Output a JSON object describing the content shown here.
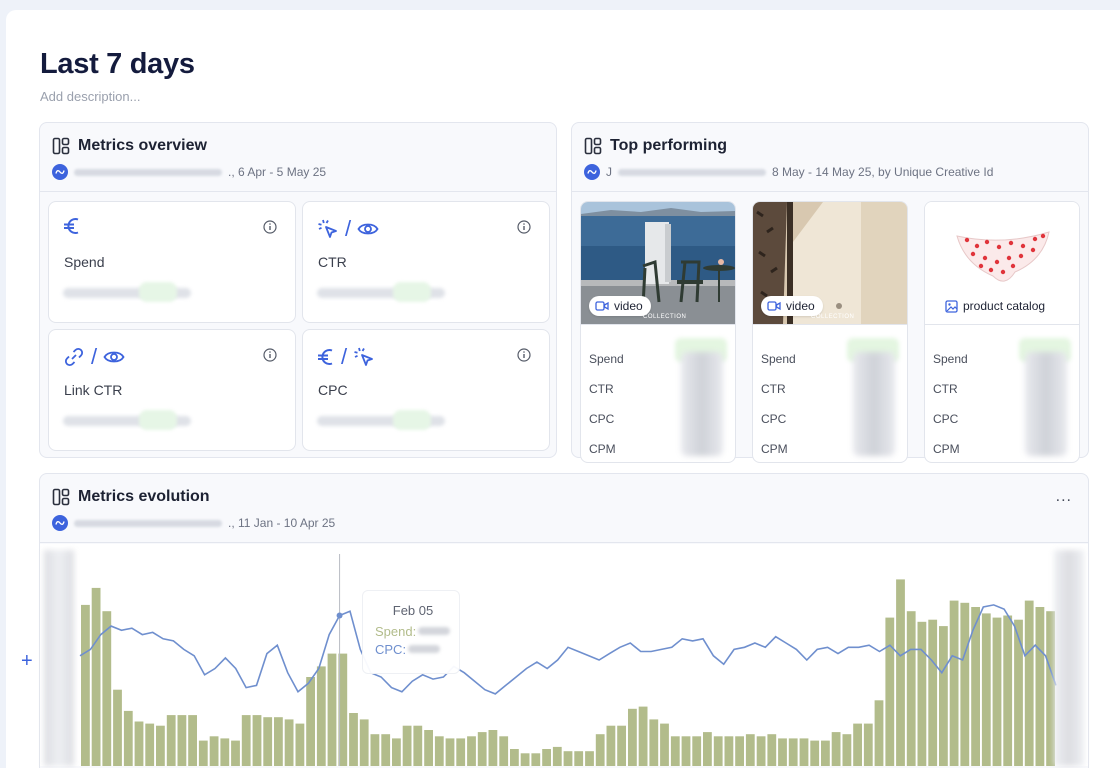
{
  "page": {
    "title": "Last 7 days",
    "description_placeholder": "Add description..."
  },
  "metrics_overview": {
    "title": "Metrics overview",
    "date_range": "., 6 Apr - 5 May 25",
    "cards": [
      {
        "label": "Spend",
        "icons": [
          "euro-icon"
        ]
      },
      {
        "label": "CTR",
        "icons": [
          "cursor-click-icon",
          "eye-icon"
        ]
      },
      {
        "label": "Link CTR",
        "icons": [
          "link-icon",
          "eye-icon"
        ]
      },
      {
        "label": "CPC",
        "icons": [
          "euro-icon",
          "cursor-click-icon"
        ]
      }
    ]
  },
  "top_performing": {
    "title": "Top performing",
    "account_prefix": "J",
    "date_range": "8 May - 14 May 25, by Unique Creative Id",
    "creatives": [
      {
        "type": "video",
        "type_icon": "video-icon",
        "overlay": "COLLECTION",
        "metrics": [
          "Spend",
          "CTR",
          "CPC",
          "CPM"
        ]
      },
      {
        "type": "video",
        "type_icon": "video-icon",
        "overlay": "COLLECTION",
        "metrics": [
          "Spend",
          "CTR",
          "CPC",
          "CPM"
        ]
      },
      {
        "type": "product catalog",
        "type_icon": "image-icon",
        "overlay": "",
        "metrics": [
          "Spend",
          "CTR",
          "CPC",
          "CPM"
        ]
      }
    ]
  },
  "metrics_evolution": {
    "title": "Metrics evolution",
    "date_range": "., 11 Jan - 10 Apr 25",
    "menu_label": "...",
    "add_label": "+",
    "tooltip": {
      "date": "Feb 05",
      "spend_label": "Spend:",
      "cpc_label": "CPC:"
    }
  },
  "chart_data": {
    "type": "bar",
    "bar_color": "#b2bc8b",
    "line_color": "#6f8fce",
    "grid": false,
    "series": [
      {
        "name": "Spend",
        "type": "bar",
        "values": [
          0.76,
          0.84,
          0.73,
          0.36,
          0.26,
          0.21,
          0.2,
          0.19,
          0.24,
          0.24,
          0.24,
          0.12,
          0.14,
          0.13,
          0.12,
          0.24,
          0.24,
          0.23,
          0.23,
          0.22,
          0.2,
          0.42,
          0.47,
          0.53,
          0.53,
          0.25,
          0.22,
          0.15,
          0.15,
          0.13,
          0.19,
          0.19,
          0.17,
          0.14,
          0.13,
          0.13,
          0.14,
          0.16,
          0.17,
          0.14,
          0.08,
          0.06,
          0.06,
          0.08,
          0.09,
          0.07,
          0.07,
          0.07,
          0.15,
          0.19,
          0.19,
          0.27,
          0.28,
          0.22,
          0.2,
          0.14,
          0.14,
          0.14,
          0.16,
          0.14,
          0.14,
          0.14,
          0.15,
          0.14,
          0.15,
          0.13,
          0.13,
          0.13,
          0.12,
          0.12,
          0.16,
          0.15,
          0.2,
          0.2,
          0.31,
          0.7,
          0.88,
          0.73,
          0.68,
          0.69,
          0.66,
          0.78,
          0.77,
          0.75,
          0.72,
          0.7,
          0.71,
          0.69,
          0.78,
          0.75,
          0.73
        ]
      },
      {
        "name": "CPC",
        "type": "line",
        "values": [
          0.52,
          0.55,
          0.62,
          0.66,
          0.64,
          0.65,
          0.62,
          0.63,
          0.6,
          0.59,
          0.55,
          0.52,
          0.43,
          0.46,
          0.51,
          0.46,
          0.37,
          0.38,
          0.53,
          0.57,
          0.44,
          0.35,
          0.39,
          0.46,
          0.62,
          0.71,
          0.73,
          0.55,
          0.44,
          0.42,
          0.37,
          0.35,
          0.4,
          0.43,
          0.41,
          0.42,
          0.47,
          0.44,
          0.4,
          0.36,
          0.34,
          0.38,
          0.42,
          0.46,
          0.49,
          0.46,
          0.5,
          0.56,
          0.54,
          0.52,
          0.5,
          0.53,
          0.56,
          0.58,
          0.54,
          0.54,
          0.55,
          0.56,
          0.6,
          0.59,
          0.6,
          0.52,
          0.48,
          0.55,
          0.56,
          0.58,
          0.56,
          0.61,
          0.58,
          0.55,
          0.5,
          0.55,
          0.56,
          0.53,
          0.56,
          0.56,
          0.57,
          0.54,
          0.57,
          0.52,
          0.55,
          0.55,
          0.5,
          0.44,
          0.52,
          0.5,
          0.64,
          0.75,
          0.76,
          0.74,
          0.66,
          0.52,
          0.57,
          0.52,
          0.38
        ]
      }
    ],
    "tooltip_index": 25
  }
}
